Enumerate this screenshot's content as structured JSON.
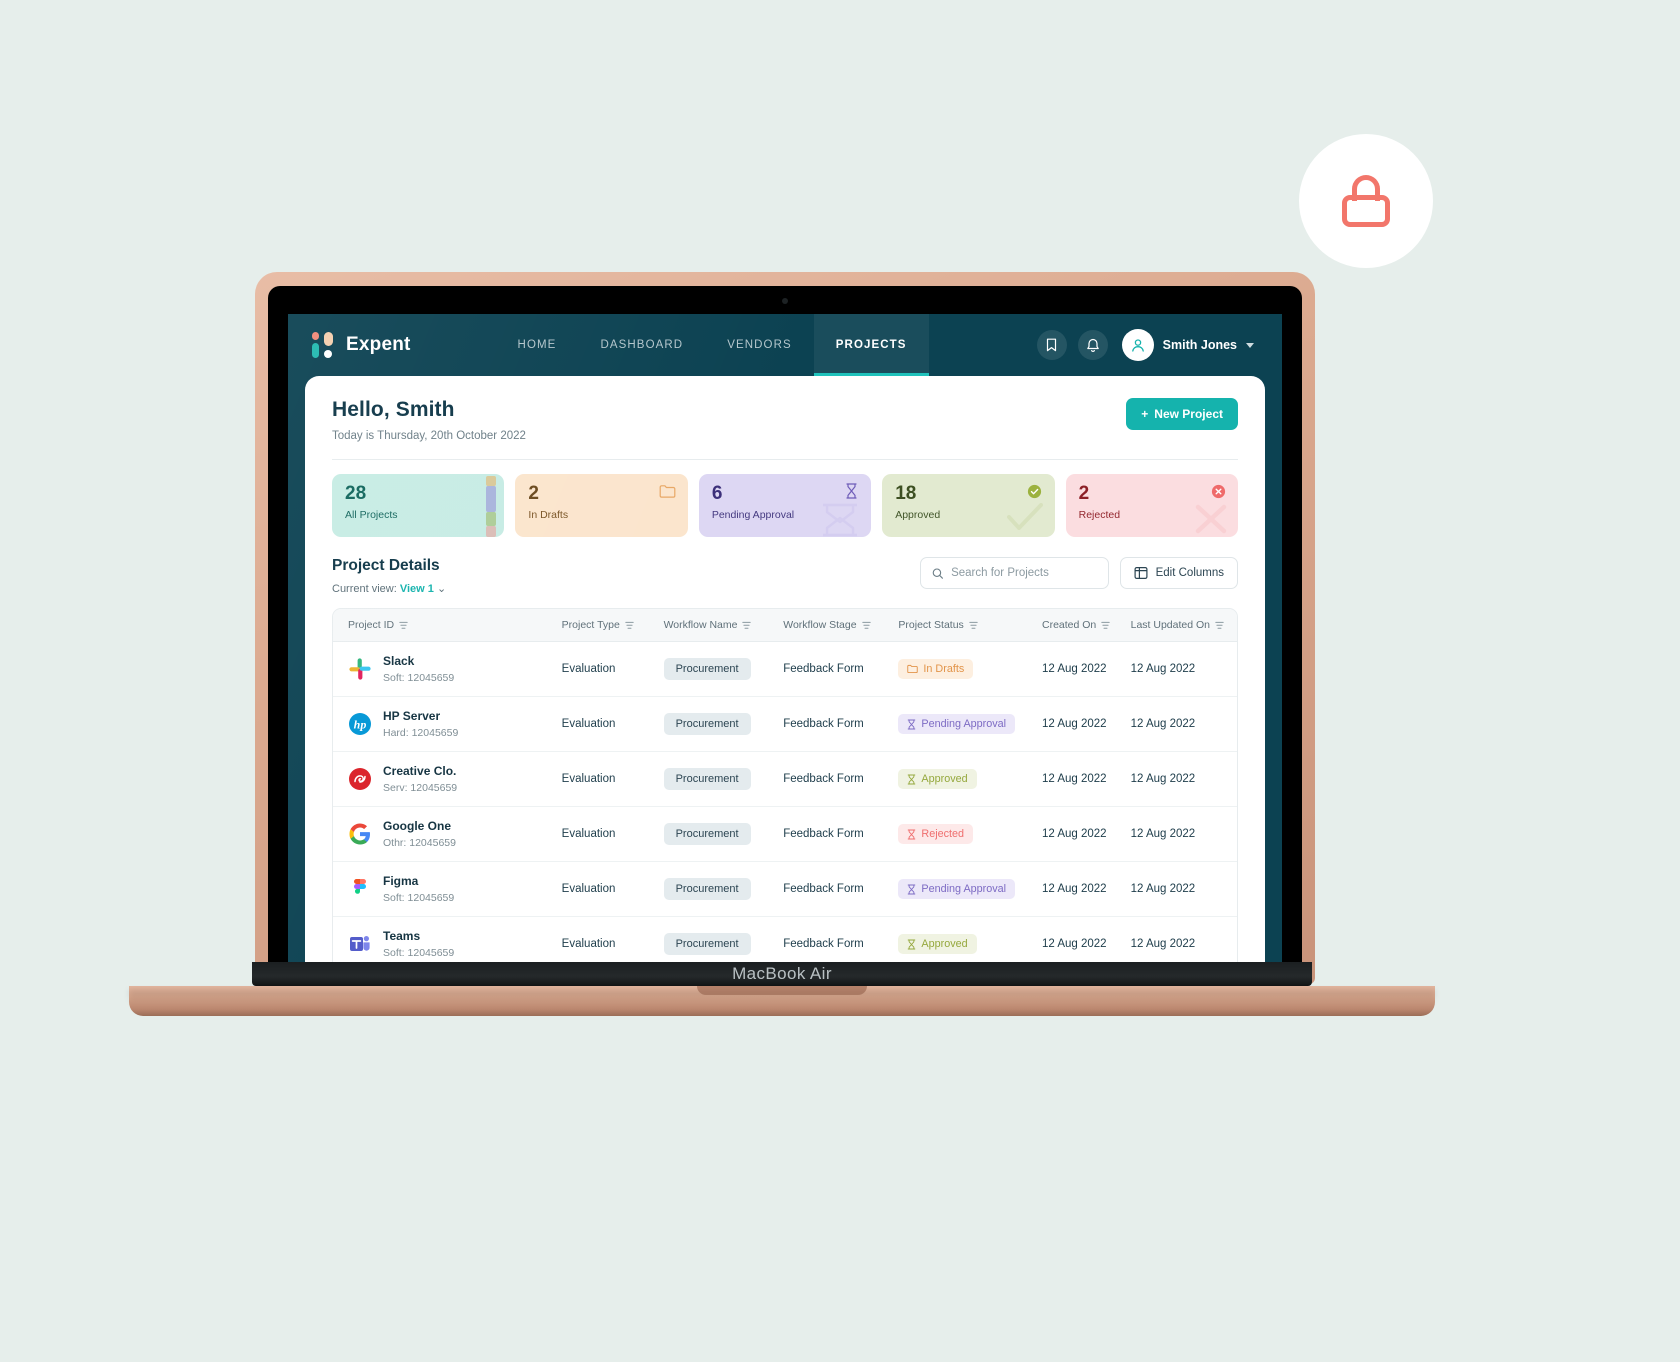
{
  "device": {
    "label": "MacBook Air"
  },
  "lock_badge": {
    "icon": "lock-icon",
    "color": "#f2766b"
  },
  "nav": {
    "brand": "Expent",
    "links": [
      {
        "label": "HOME",
        "active": false
      },
      {
        "label": "DASHBOARD",
        "active": false
      },
      {
        "label": "VENDORS",
        "active": false
      },
      {
        "label": "PROJECTS",
        "active": true
      }
    ],
    "bookmark_icon": "bookmark-icon",
    "bell_icon": "bell-icon",
    "user": "Smith Jones",
    "avatar_icon": "user-avatar-icon",
    "caret_icon": "chevron-down-icon",
    "bg_color": "#0c4252",
    "accent_color": "#1fc2bb"
  },
  "greeting": {
    "title": "Hello, Smith",
    "subtitle": "Today is Thursday, 20th October 2022",
    "new_project_label": "New Project",
    "new_project_plus": "+"
  },
  "stats": [
    {
      "value": "28",
      "label": "All Projects",
      "bg": "#c7ece4",
      "num_color": "#11665c",
      "lbl_color": "#17685f",
      "icon": ""
    },
    {
      "value": "2",
      "label": "In Drafts",
      "bg": "#fbe5cd",
      "num_color": "#6b4a1e",
      "lbl_color": "#7a5526",
      "icon": "folder-icon"
    },
    {
      "value": "6",
      "label": "Pending Approval",
      "bg": "#ddd7f3",
      "num_color": "#3c2f7a",
      "lbl_color": "#453a80",
      "icon": "hourglass-icon"
    },
    {
      "value": "18",
      "label": "Approved",
      "bg": "#e2ead0",
      "num_color": "#3d5022",
      "lbl_color": "#42562a",
      "icon": "check-circle-icon"
    },
    {
      "value": "2",
      "label": "Rejected",
      "bg": "#fbdde0",
      "num_color": "#8c2027",
      "lbl_color": "#94282f",
      "icon": "x-circle-icon"
    }
  ],
  "project_details": {
    "title": "Project Details",
    "current_view_label": "Current view:",
    "current_view_value": "View 1",
    "view_caret_icon": "chevron-down-icon",
    "search_placeholder": "Search for Projects",
    "search_value": "",
    "search_icon": "search-icon",
    "edit_columns_label": "Edit Columns",
    "edit_columns_icon": "columns-icon",
    "columns": [
      "Project ID",
      "Project Type",
      "Workflow Name",
      "Workflow Stage",
      "Project Status",
      "Created On",
      "Last Updated On"
    ],
    "filter_icon": "filter-icon",
    "rows": [
      {
        "logo": "slack-logo",
        "name": "Slack",
        "id": "Soft: 12045659",
        "type": "Evaluation",
        "workflow": "Procurement",
        "stage": "Feedback Form",
        "status": "In Drafts",
        "status_class": "b-draft",
        "status_icon": "folder-icon",
        "created": "12 Aug 2022",
        "updated": "12 Aug 2022"
      },
      {
        "logo": "hp-logo",
        "name": "HP Server",
        "id": "Hard: 12045659",
        "type": "Evaluation",
        "workflow": "Procurement",
        "stage": "Feedback Form",
        "status": "Pending Approval",
        "status_class": "b-pending",
        "status_icon": "hourglass-icon",
        "created": "12 Aug 2022",
        "updated": "12 Aug 2022"
      },
      {
        "logo": "adobe-logo",
        "name": "Creative Clo.",
        "id": "Serv: 12045659",
        "type": "Evaluation",
        "workflow": "Procurement",
        "stage": "Feedback Form",
        "status": "Approved",
        "status_class": "b-approved",
        "status_icon": "hourglass-icon",
        "created": "12 Aug 2022",
        "updated": "12 Aug 2022"
      },
      {
        "logo": "google-logo",
        "name": "Google One",
        "id": "Othr: 12045659",
        "type": "Evaluation",
        "workflow": "Procurement",
        "stage": "Feedback Form",
        "status": "Rejected",
        "status_class": "b-rejected",
        "status_icon": "hourglass-icon",
        "created": "12 Aug 2022",
        "updated": "12 Aug 2022"
      },
      {
        "logo": "figma-logo",
        "name": "Figma",
        "id": "Soft: 12045659",
        "type": "Evaluation",
        "workflow": "Procurement",
        "stage": "Feedback Form",
        "status": "Pending Approval",
        "status_class": "b-pending",
        "status_icon": "hourglass-icon",
        "created": "12 Aug 2022",
        "updated": "12 Aug 2022"
      },
      {
        "logo": "teams-logo",
        "name": "Teams",
        "id": "Soft: 12045659",
        "type": "Evaluation",
        "workflow": "Procurement",
        "stage": "Feedback Form",
        "status": "Approved",
        "status_class": "b-approved",
        "status_icon": "hourglass-icon",
        "created": "12 Aug 2022",
        "updated": "12 Aug 2022"
      }
    ]
  }
}
